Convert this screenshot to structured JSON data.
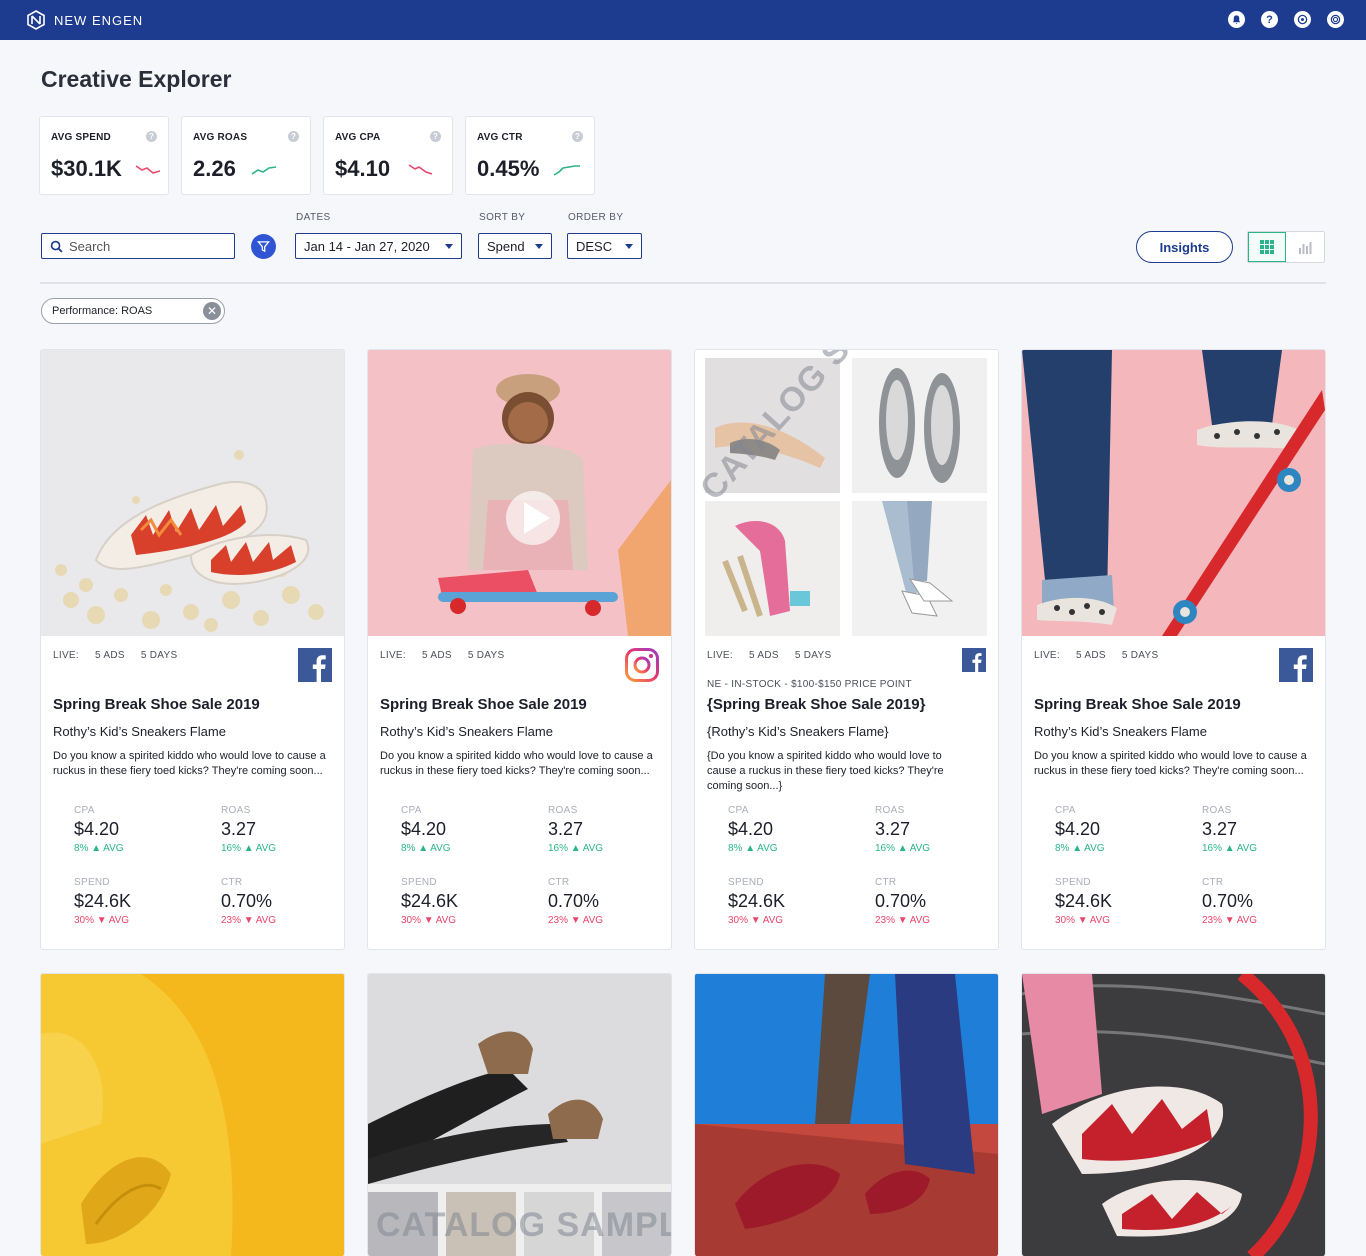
{
  "app": {
    "brand": "NEW ENGEN",
    "page_title": "Creative Explorer"
  },
  "topbar": {
    "icons": [
      "bell-icon",
      "help-icon",
      "target-icon",
      "account-icon"
    ]
  },
  "kpis": [
    {
      "label": "AVG SPEND",
      "value": "$30.1K",
      "trend": "down",
      "trend_color": "#e8466b"
    },
    {
      "label": "AVG ROAS",
      "value": "2.26",
      "trend": "up",
      "trend_color": "#2bb38a"
    },
    {
      "label": "AVG CPA",
      "value": "$4.10",
      "trend": "down",
      "trend_color": "#e8466b"
    },
    {
      "label": "AVG CTR",
      "value": "0.45%",
      "trend": "up",
      "trend_color": "#2bb38a"
    }
  ],
  "controls": {
    "search_placeholder": "Search",
    "dates_label": "DATES",
    "dates_value": "Jan 14 - Jan 27, 2020",
    "sort_label": "SORT BY",
    "sort_value": "Spend",
    "order_label": "ORDER BY",
    "order_value": "DESC",
    "insights_label": "Insights"
  },
  "filter_chip": "Performance: ROAS",
  "cards": [
    {
      "platform": "facebook",
      "live_label": "LIVE:",
      "ads": "5 ADS",
      "days": "5 DAYS",
      "title": "Spring Break Shoe Sale 2019",
      "subtitle": "Rothy’s Kid’s Sneakers Flame",
      "description": "Do you know a spirited kiddo who would love to cause a ruckus in these fiery toed kicks? They're coming soon...",
      "metrics": {
        "cpa": {
          "label": "CPA",
          "value": "$4.20",
          "delta": "8%",
          "avg": "AVG"
        },
        "roas": {
          "label": "ROAS",
          "value": "3.27",
          "delta": "16%",
          "avg": "AVG"
        },
        "spend": {
          "label": "SPEND",
          "value": "$24.6K",
          "delta": "30%",
          "avg": "AVG"
        },
        "ctr": {
          "label": "CTR",
          "value": "0.70%",
          "delta": "23%",
          "avg": "AVG"
        }
      }
    },
    {
      "platform": "instagram",
      "live_label": "LIVE:",
      "ads": "5 ADS",
      "days": "5 DAYS",
      "title": "Spring Break Shoe Sale 2019",
      "subtitle": "Rothy’s Kid’s Sneakers Flame",
      "description": "Do you know a spirited kiddo who would love to cause a ruckus in these fiery toed kicks? They're coming soon...",
      "metrics": {
        "cpa": {
          "label": "CPA",
          "value": "$4.20",
          "delta": "8%",
          "avg": "AVG"
        },
        "roas": {
          "label": "ROAS",
          "value": "3.27",
          "delta": "16%",
          "avg": "AVG"
        },
        "spend": {
          "label": "SPEND",
          "value": "$24.6K",
          "delta": "30%",
          "avg": "AVG"
        },
        "ctr": {
          "label": "CTR",
          "value": "0.70%",
          "delta": "23%",
          "avg": "AVG"
        }
      }
    },
    {
      "platform": "facebook",
      "live_label": "LIVE:",
      "ads": "5 ADS",
      "days": "5 DAYS",
      "catalog_tag": "NE - IN-STOCK - $100-$150 PRICE POINT",
      "watermark": "CATALOG SAMPLE",
      "title": "{Spring Break Shoe Sale 2019}",
      "subtitle": "{Rothy’s Kid’s Sneakers Flame}",
      "description": "{Do you know a spirited kiddo who would love to cause a ruckus in these fiery toed kicks? They're coming soon...}",
      "metrics": {
        "cpa": {
          "label": "CPA",
          "value": "$4.20",
          "delta": "8%",
          "avg": "AVG"
        },
        "roas": {
          "label": "ROAS",
          "value": "3.27",
          "delta": "16%",
          "avg": "AVG"
        },
        "spend": {
          "label": "SPEND",
          "value": "$24.6K",
          "delta": "30%",
          "avg": "AVG"
        },
        "ctr": {
          "label": "CTR",
          "value": "0.70%",
          "delta": "23%",
          "avg": "AVG"
        }
      }
    },
    {
      "platform": "facebook",
      "live_label": "LIVE:",
      "ads": "5 ADS",
      "days": "5 DAYS",
      "title": "Spring Break Shoe Sale 2019",
      "subtitle": "Rothy’s Kid’s Sneakers Flame",
      "description": "Do you know a spirited kiddo who would love to cause a ruckus in these fiery toed kicks? They're coming soon...",
      "metrics": {
        "cpa": {
          "label": "CPA",
          "value": "$4.20",
          "delta": "8%",
          "avg": "AVG"
        },
        "roas": {
          "label": "ROAS",
          "value": "3.27",
          "delta": "16%",
          "avg": "AVG"
        },
        "spend": {
          "label": "SPEND",
          "value": "$24.6K",
          "delta": "30%",
          "avg": "AVG"
        },
        "ctr": {
          "label": "CTR",
          "value": "0.70%",
          "delta": "23%",
          "avg": "AVG"
        }
      }
    }
  ],
  "row2": {
    "watermark": "CATALOG SAMPLE"
  },
  "colors": {
    "brand": "#1d3c8f",
    "positive": "#2bb38a",
    "negative": "#e8466b",
    "filter_button": "#2f55d4"
  }
}
